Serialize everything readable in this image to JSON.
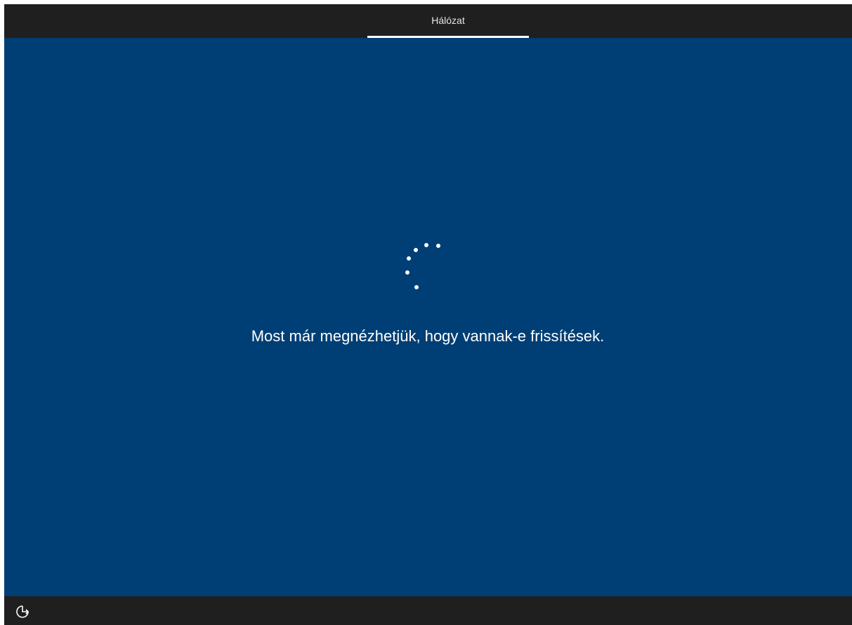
{
  "header": {
    "tabs": [
      {
        "label": "Hálózat",
        "active": true
      }
    ]
  },
  "main": {
    "status_text": "Most már megnézhetjük, hogy vannak-e frissítések.",
    "spinner_icon": "loading-dots-icon"
  },
  "footer": {
    "accessibility_icon": "accessibility-icon"
  },
  "colors": {
    "background": "#003f75",
    "bars": "#1f1f1f",
    "text": "#ffffff"
  }
}
